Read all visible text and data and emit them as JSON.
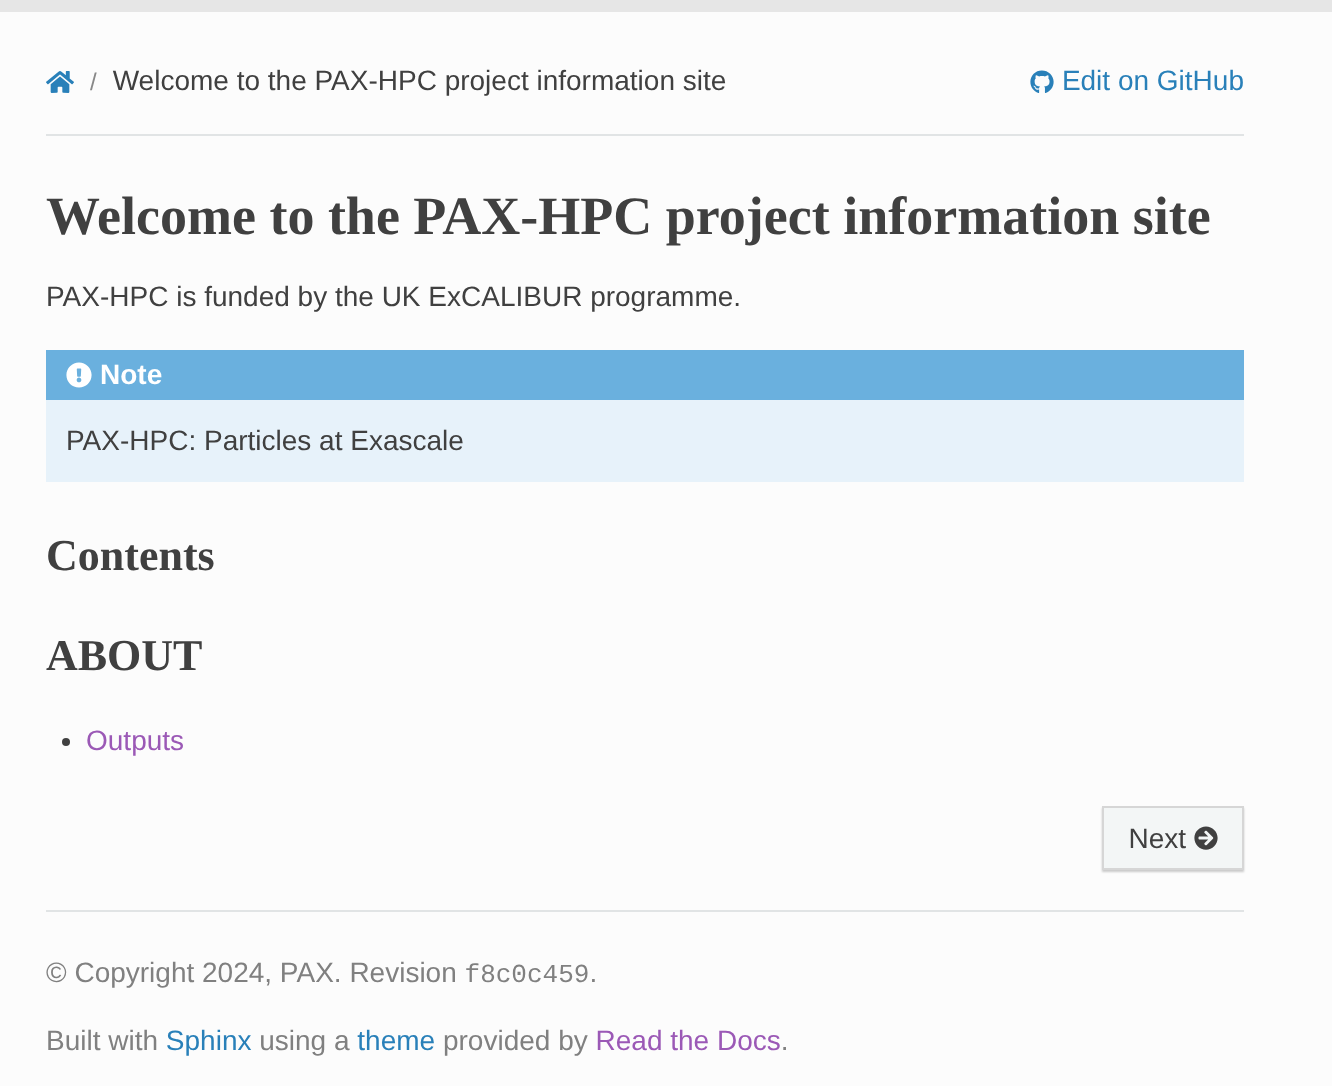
{
  "breadcrumb": {
    "current": "Welcome to the PAX-HPC project information site",
    "separator": "/",
    "edit_link": "Edit on GitHub"
  },
  "title": "Welcome to the PAX-HPC project information site",
  "intro": "PAX-HPC is funded by the UK ExCALIBUR programme.",
  "note": {
    "title": "Note",
    "body": "PAX-HPC: Particles at Exascale"
  },
  "contents_heading": "Contents",
  "sections": [
    {
      "heading": "ABOUT",
      "items": [
        {
          "label": "Outputs",
          "visited": true
        }
      ]
    }
  ],
  "next_button": "Next",
  "footer": [
    {
      "parts": [
        {
          "kind": "text",
          "text": "© Copyright 2024, PAX. Revision "
        },
        {
          "kind": "code",
          "text": "f8c0c459"
        },
        {
          "kind": "text",
          "text": "."
        }
      ]
    },
    {
      "parts": [
        {
          "kind": "text",
          "text": "Built with "
        },
        {
          "kind": "link",
          "text": "Sphinx",
          "visited": false
        },
        {
          "kind": "text",
          "text": " using a "
        },
        {
          "kind": "link",
          "text": "theme",
          "visited": false
        },
        {
          "kind": "text",
          "text": " provided by "
        },
        {
          "kind": "link",
          "text": "Read the Docs",
          "visited": true
        },
        {
          "kind": "text",
          "text": "."
        }
      ]
    }
  ]
}
